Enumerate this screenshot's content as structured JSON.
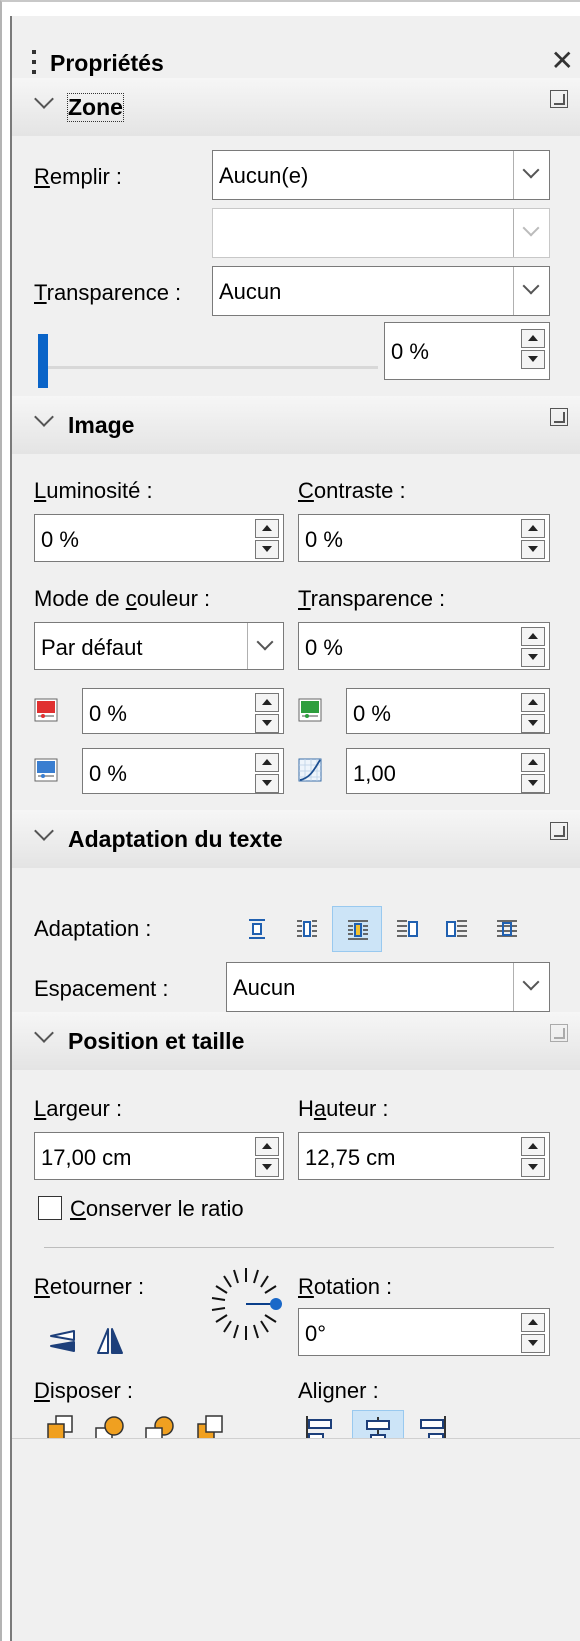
{
  "panel": {
    "title": "Propriétés"
  },
  "zone": {
    "title": "Zone",
    "fill_label_u": "R",
    "fill_label_rest": "emplir :",
    "fill_value": "Aucun(e)",
    "fill_secondary_value": "",
    "transparency_label_u": "T",
    "transparency_label_rest": "ransparence :",
    "transparency_value": "Aucun",
    "transparency_percent": "0 %",
    "transparency_slider_fraction": 0
  },
  "image": {
    "title": "Image",
    "brightness_label_u": "L",
    "brightness_label_rest": "uminosité :",
    "brightness_value": "0 %",
    "contrast_label_u": "C",
    "contrast_label_rest": "ontraste :",
    "contrast_value": "0 %",
    "color_mode_label_pre": "Mode de ",
    "color_mode_label_u": "c",
    "color_mode_label_rest": "ouleur :",
    "color_mode_value": "Par défaut",
    "transparency_label_u": "T",
    "transparency_label_rest": "ransparence :",
    "transparency_value": "0 %",
    "red_value": "0 %",
    "green_value": "0 %",
    "blue_value": "0 %",
    "gamma_value": "1,00"
  },
  "wrap": {
    "title": "Adaptation du texte",
    "adaptation_label": "Adaptation :",
    "spacing_label": "Espacement :",
    "spacing_value": "Aucun"
  },
  "position": {
    "title": "Position et taille",
    "width_label_u": "L",
    "width_label_rest": "argeur :",
    "width_value": "17,00 cm",
    "height_label_pre": "H",
    "height_label_u": "a",
    "height_label_rest": "uteur :",
    "height_value": "12,75 cm",
    "keep_ratio_u": "C",
    "keep_ratio_rest": "onserver le ratio",
    "flip_label_u": "R",
    "flip_label_rest": "etourner :",
    "rotation_label_u": "R",
    "rotation_label_rest": "otation :",
    "rotation_value": "0°",
    "arrange_label_u": "D",
    "arrange_label_rest": "isposer :",
    "align_label": "Aligner :"
  },
  "icons": {
    "red": "red-channel-icon",
    "green": "green-channel-icon",
    "blue": "blue-channel-icon",
    "gamma": "gamma-icon"
  },
  "colors": {
    "accent": "#0a64c8",
    "selected_bg": "#cce4f7",
    "red": "#e03030",
    "green": "#2e9e3e",
    "blue": "#3a7ed0",
    "orange": "#f0a020"
  }
}
